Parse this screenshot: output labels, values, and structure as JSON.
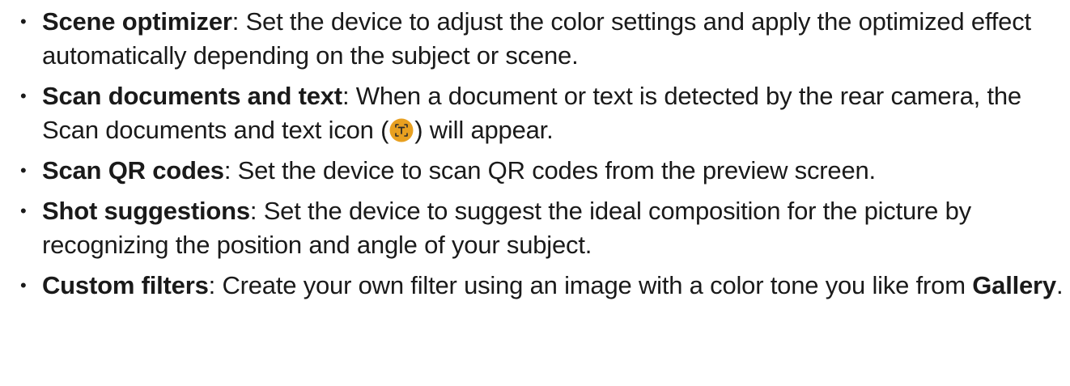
{
  "items": [
    {
      "term": "Scene optimizer",
      "text": ": Set the device to adjust the color settings and apply the optimized effect automatically depending on the subject or scene."
    },
    {
      "term": "Scan documents and text",
      "text_before_icon": ": When a document or text is detected by the rear camera, the Scan documents and text icon (",
      "icon": "scan-documents-text-icon",
      "text_after_icon": ") will appear."
    },
    {
      "term": "Scan QR codes",
      "text": ": Set the device to scan QR codes from the preview screen."
    },
    {
      "term": "Shot suggestions",
      "text": ": Set the device to suggest the ideal composition for the picture by recognizing the position and angle of your subject."
    },
    {
      "term": "Custom filters",
      "text": ": Create your own filter using an image with a color tone you like from ",
      "link_term": "Gallery",
      "text_end": "."
    }
  ],
  "bullet": "•",
  "colors": {
    "text": "#1a1a1a",
    "icon_fill": "#e8a020",
    "icon_glyph": "#2a2a2a"
  }
}
